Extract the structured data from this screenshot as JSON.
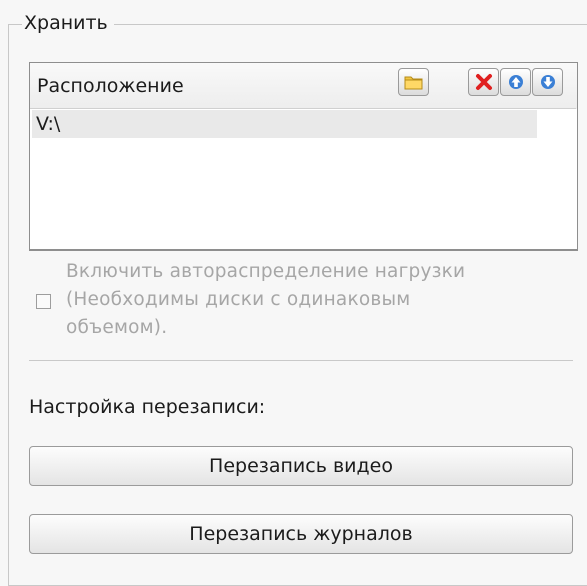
{
  "group": {
    "title": "Хранить"
  },
  "location": {
    "header": "Расположение",
    "toolbar": [
      {
        "icon": "folder-icon",
        "color": "#f2c744"
      },
      {
        "icon": "delete-icon",
        "color": "#e02020"
      },
      {
        "icon": "arrow-up-icon",
        "color": "#3a7fd5"
      },
      {
        "icon": "arrow-down-icon",
        "color": "#3a7fd5"
      }
    ],
    "items": [
      "V:\\"
    ]
  },
  "load_balance": {
    "checked": false,
    "line1": "Включить автораспределение нагрузки",
    "line2": "(Необходимы диски с одинаковым",
    "line3": "объемом)."
  },
  "overwrite": {
    "label": "Настройка перезаписи:",
    "video_button": "Перезапись видео",
    "logs_button": "Перезапись журналов"
  }
}
